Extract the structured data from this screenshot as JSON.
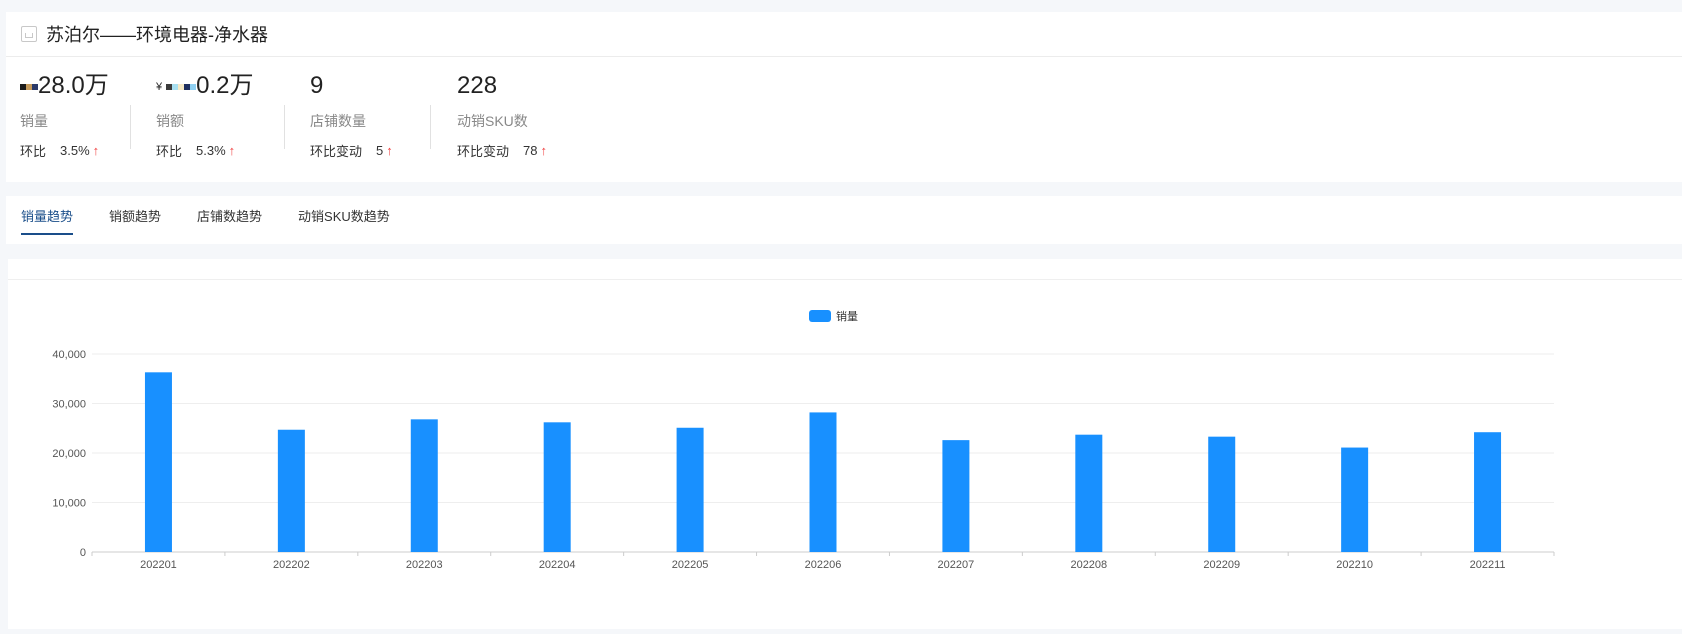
{
  "header": {
    "title": "苏泊尔——环境电器-净水器",
    "metrics": [
      {
        "value": "28.0万",
        "label": "销量",
        "change_label": "环比",
        "change_value": "3.5%",
        "arrow": "↑"
      },
      {
        "prefix": "¥",
        "value": "0.2万",
        "label": "销额",
        "change_label": "环比",
        "change_value": "5.3%",
        "arrow": "↑"
      },
      {
        "value": "9",
        "label": "店铺数量",
        "change_label": "环比变动",
        "change_value": "5",
        "arrow": "↑"
      },
      {
        "value": "228",
        "label": "动销SKU数",
        "change_label": "环比变动",
        "change_value": "78",
        "arrow": "↑"
      }
    ]
  },
  "tabs": [
    {
      "label": "销量趋势",
      "active": true
    },
    {
      "label": "销额趋势",
      "active": false
    },
    {
      "label": "店铺数趋势",
      "active": false
    },
    {
      "label": "动销SKU数趋势",
      "active": false
    }
  ],
  "chart_data": {
    "type": "bar",
    "categories": [
      "202201",
      "202202",
      "202203",
      "202204",
      "202205",
      "202206",
      "202207",
      "202208",
      "202209",
      "202210",
      "202211"
    ],
    "series": [
      {
        "name": "销量",
        "values": [
          36300,
          24700,
          26800,
          26200,
          25100,
          28200,
          22600,
          23700,
          23300,
          21100,
          24200
        ],
        "color": "#1890ff"
      }
    ],
    "ylim": [
      0,
      40000
    ],
    "yticks": [
      0,
      10000,
      20000,
      30000,
      40000
    ],
    "ytick_labels": [
      "0",
      "10,000",
      "20,000",
      "30,000",
      "40,000"
    ],
    "legend": "top-center",
    "grid": true
  }
}
